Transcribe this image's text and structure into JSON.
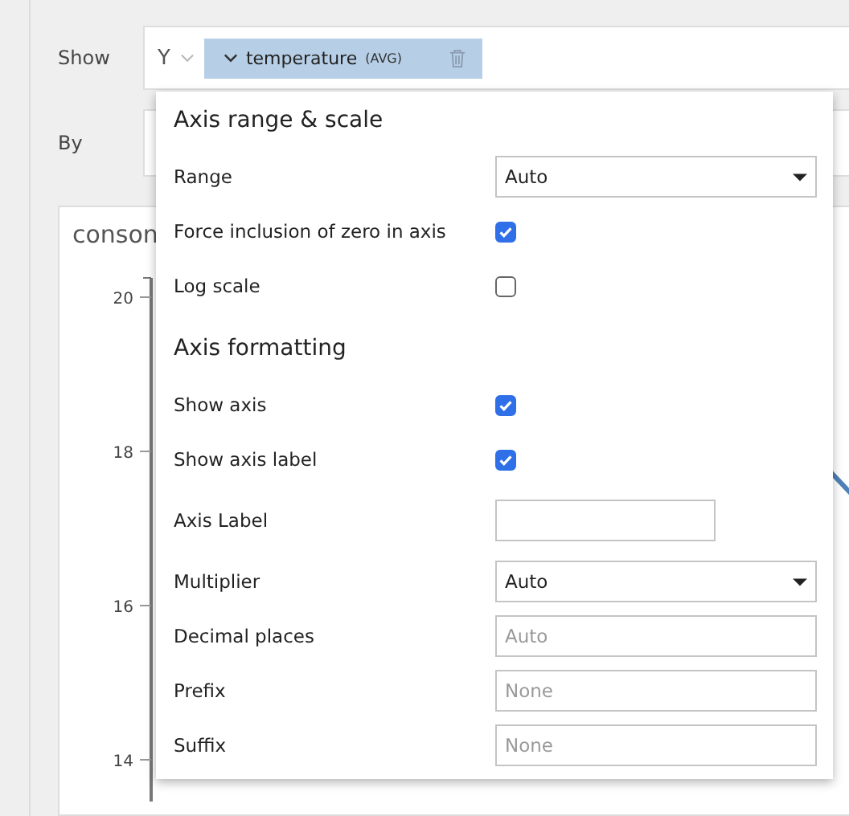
{
  "show": {
    "label": "Show",
    "axis": "Y",
    "measure": {
      "name": "temperature",
      "aggregate": "(AVG)"
    }
  },
  "by": {
    "label": "By"
  },
  "chart": {
    "title": "conson",
    "y_ticks": [
      "20",
      "18",
      "16",
      "14"
    ]
  },
  "axis_popup": {
    "sections": [
      {
        "heading": "Axis range & scale",
        "rows": [
          {
            "kind": "select",
            "label": "Range",
            "value": "Auto"
          },
          {
            "kind": "checkbox",
            "label": "Force inclusion of zero in axis",
            "checked": true
          },
          {
            "kind": "checkbox",
            "label": "Log scale",
            "checked": false
          }
        ]
      },
      {
        "heading": "Axis formatting",
        "rows": [
          {
            "kind": "checkbox",
            "label": "Show axis",
            "checked": true
          },
          {
            "kind": "checkbox",
            "label": "Show axis label",
            "checked": true
          },
          {
            "kind": "text",
            "label": "Axis Label",
            "short": true
          },
          {
            "kind": "select",
            "label": "Multiplier",
            "value": "Auto"
          },
          {
            "kind": "text",
            "label": "Decimal places",
            "placeholder": "Auto"
          },
          {
            "kind": "text",
            "label": "Prefix",
            "placeholder": "None"
          },
          {
            "kind": "text",
            "label": "Suffix",
            "placeholder": "None"
          }
        ]
      }
    ]
  }
}
